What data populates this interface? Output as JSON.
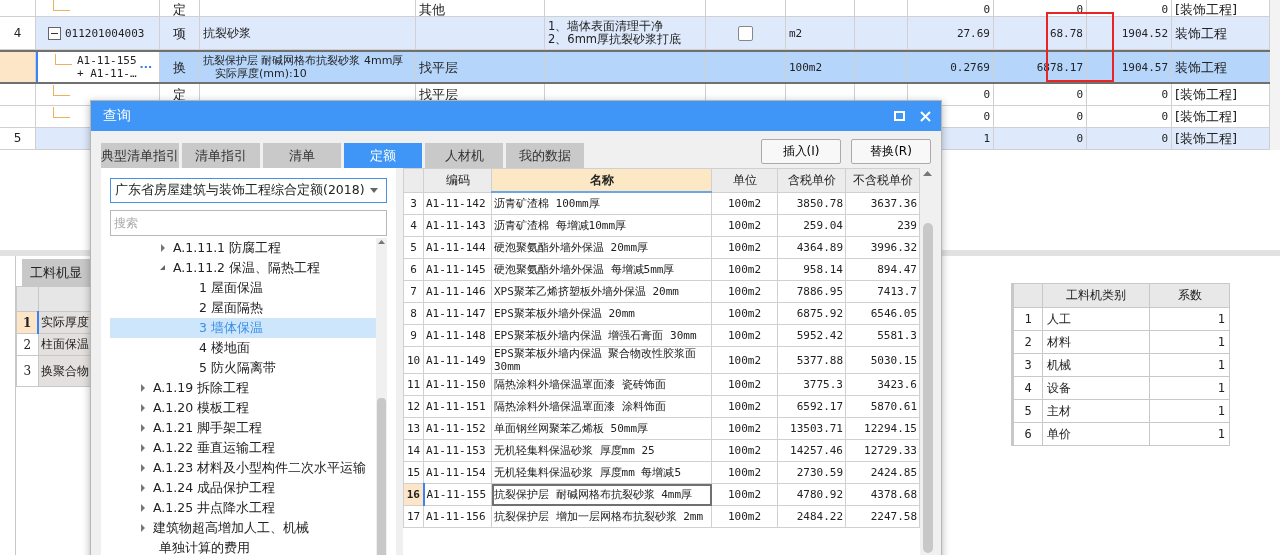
{
  "main_grid": {
    "rows": [
      {
        "kind": "child",
        "type": "定",
        "column_5": "其他",
        "qty": "0",
        "price": "0",
        "total": "0",
        "category": "[装饰工程]"
      },
      {
        "kind": "parent",
        "expanded": true,
        "num": "4",
        "code": "011201004003",
        "type": "项",
        "name": "抗裂砂浆",
        "features": [
          "1、墙体表面清理干净",
          "2、6mm厚抗裂砂浆打底"
        ],
        "checked": false,
        "unit": "m2",
        "qty": "27.69",
        "price": "68.78",
        "total": "1904.52",
        "category": "装饰工程"
      },
      {
        "kind": "child",
        "selected": true,
        "code_lines": [
          "A1-11-155",
          "+ A1-11-…"
        ],
        "more": "···",
        "type": "换",
        "name_lines": [
          "抗裂保护层 耐碱网格布抗裂砂浆 4mm厚",
          "实际厚度(mm):10"
        ],
        "column_5": "找平层",
        "unit": "100m2",
        "qty": "0.2769",
        "price": "6878.17",
        "total": "1904.57",
        "category": "装饰工程"
      },
      {
        "kind": "child",
        "type": "定",
        "column_5": "找平层",
        "qty": "0",
        "price": "0",
        "total": "0",
        "category": "[装饰工程]"
      },
      {
        "kind": "child",
        "qty": "0",
        "price": "0",
        "total": "0",
        "category": "[装饰工程]"
      },
      {
        "kind": "parent",
        "num": "5",
        "qty": "1",
        "price": "0",
        "total": "0",
        "category": "[装饰工程]"
      }
    ]
  },
  "bottom_tab": "工料机显",
  "detail_table": {
    "rows": [
      {
        "num": "1",
        "text": "实际厚度",
        "selected": true
      },
      {
        "num": "2",
        "text": "柱面保温",
        "selected": false
      },
      {
        "num": "3",
        "text": "换聚合物",
        "selected": false
      }
    ]
  },
  "factor_table": {
    "columns": [
      "工料机类别",
      "系数"
    ],
    "rows": [
      {
        "num": "1",
        "category": "人工",
        "factor": "1"
      },
      {
        "num": "2",
        "category": "材料",
        "factor": "1"
      },
      {
        "num": "3",
        "category": "机械",
        "factor": "1"
      },
      {
        "num": "4",
        "category": "设备",
        "factor": "1"
      },
      {
        "num": "5",
        "category": "主材",
        "factor": "1"
      },
      {
        "num": "6",
        "category": "单价",
        "factor": "1"
      }
    ]
  },
  "dialog": {
    "title": "查询",
    "tabs": [
      {
        "label": "典型清单指引",
        "selected": false
      },
      {
        "label": "清单指引",
        "selected": false
      },
      {
        "label": "清单",
        "selected": false
      },
      {
        "label": "定额",
        "selected": true
      },
      {
        "label": "人材机",
        "selected": false
      },
      {
        "label": "我的数据",
        "selected": false
      }
    ],
    "buttons": [
      "插入(I)",
      "替换(R)"
    ],
    "library": "广东省房屋建筑与装饰工程综合定额(2018)",
    "search": {
      "placeholder": "搜索"
    },
    "tree": [
      {
        "children": [
          {
            "label": "A.1.11.1 防腐工程",
            "expanded": false,
            "selected": false
          },
          {
            "label": "A.1.11.2 保温、隔热工程",
            "expanded": true,
            "selected": false,
            "children": [
              {
                "label": "1 屋面保温",
                "selected": false
              },
              {
                "label": "2 屋面隔热",
                "selected": false
              },
              {
                "label": "3 墙体保温",
                "selected": true
              },
              {
                "label": "4 楼地面",
                "selected": false
              },
              {
                "label": "5 防火隔离带",
                "selected": false
              }
            ]
          }
        ]
      },
      {
        "label": "A.1.19 拆除工程",
        "expanded": false,
        "selected": false
      },
      {
        "label": "A.1.20 模板工程",
        "expanded": false,
        "selected": false
      },
      {
        "label": "A.1.21 脚手架工程",
        "expanded": false,
        "selected": false
      },
      {
        "label": "A.1.22 垂直运输工程",
        "expanded": false,
        "selected": false
      },
      {
        "label": "A.1.23 材料及小型构件二次水平运输",
        "expanded": false,
        "selected": false
      },
      {
        "label": "A.1.24 成品保护工程",
        "expanded": false,
        "selected": false
      },
      {
        "label": "A.1.25 井点降水工程",
        "expanded": false,
        "selected": false
      },
      {
        "label": "建筑物超高增加人工、机械",
        "expanded": false,
        "selected": false
      },
      {
        "label": "单独计算的费用",
        "selected": false
      }
    ],
    "table": {
      "columns": [
        {
          "label": "编码",
          "selected": false
        },
        {
          "label": "名称",
          "selected": true
        },
        {
          "label": "单位",
          "selected": false
        },
        {
          "label": "含税单价",
          "selected": false
        },
        {
          "label": "不含税单价",
          "selected": false
        }
      ],
      "rows": [
        {
          "num": "3",
          "code": "A1-11-142",
          "name": "沥青矿渣棉 100mm厚",
          "unit": "100m2",
          "price_tax": "3850.78",
          "price": "3637.36",
          "selected": false
        },
        {
          "num": "4",
          "code": "A1-11-143",
          "name": "沥青矿渣棉 每增减10mm厚",
          "unit": "100m2",
          "price_tax": "259.04",
          "price": "239",
          "selected": false
        },
        {
          "num": "5",
          "code": "A1-11-144",
          "name": "硬泡聚氨酯外墙外保温 20mm厚",
          "unit": "100m2",
          "price_tax": "4364.89",
          "price": "3996.32",
          "selected": false
        },
        {
          "num": "6",
          "code": "A1-11-145",
          "name": "硬泡聚氨酯外墙外保温 每增减5mm厚",
          "unit": "100m2",
          "price_tax": "958.14",
          "price": "894.47",
          "selected": false
        },
        {
          "num": "7",
          "code": "A1-11-146",
          "name": "XPS聚苯乙烯挤塑板外墙外保温 20mm",
          "unit": "100m2",
          "price_tax": "7886.95",
          "price": "7413.7",
          "selected": false
        },
        {
          "num": "8",
          "code": "A1-11-147",
          "name": "EPS聚苯板外墙外保温 20mm",
          "unit": "100m2",
          "price_tax": "6875.92",
          "price": "6546.05",
          "selected": false
        },
        {
          "num": "9",
          "code": "A1-11-148",
          "name": "EPS聚苯板外墙内保温 增强石膏面 30mm",
          "unit": "100m2",
          "price_tax": "5952.42",
          "price": "5581.3",
          "selected": false
        },
        {
          "num": "10",
          "code": "A1-11-149",
          "name": "EPS聚苯板外墙内保温 聚合物改性胶浆面 30mm",
          "unit": "100m2",
          "price_tax": "5377.88",
          "price": "5030.15",
          "selected": false
        },
        {
          "num": "11",
          "code": "A1-11-150",
          "name": "隔热涂料外墙保温罩面漆 瓷砖饰面",
          "unit": "100m2",
          "price_tax": "3775.3",
          "price": "3423.6",
          "selected": false
        },
        {
          "num": "12",
          "code": "A1-11-151",
          "name": "隔热涂料外墙保温罩面漆 涂料饰面",
          "unit": "100m2",
          "price_tax": "6592.17",
          "price": "5870.61",
          "selected": false
        },
        {
          "num": "13",
          "code": "A1-11-152",
          "name": "单面钢丝网聚苯乙烯板 50mm厚",
          "unit": "100m2",
          "price_tax": "13503.71",
          "price": "12294.15",
          "selected": false
        },
        {
          "num": "14",
          "code": "A1-11-153",
          "name": "无机轻集料保温砂浆 厚度mm 25",
          "unit": "100m2",
          "price_tax": "14257.46",
          "price": "12729.33",
          "selected": false
        },
        {
          "num": "15",
          "code": "A1-11-154",
          "name": "无机轻集料保温砂浆 厚度mm 每增减5",
          "unit": "100m2",
          "price_tax": "2730.59",
          "price": "2424.85",
          "selected": false
        },
        {
          "num": "16",
          "code": "A1-11-155",
          "name": "抗裂保护层 耐碱网格布抗裂砂浆 4mm厚",
          "unit": "100m2",
          "price_tax": "4780.92",
          "price": "4378.68",
          "selected": true
        },
        {
          "num": "17",
          "code": "A1-11-156",
          "name": "抗裂保护层 增加一层网格布抗裂砂浆 2mm",
          "unit": "100m2",
          "price_tax": "2484.22",
          "price": "2247.58",
          "selected": false
        }
      ]
    }
  }
}
